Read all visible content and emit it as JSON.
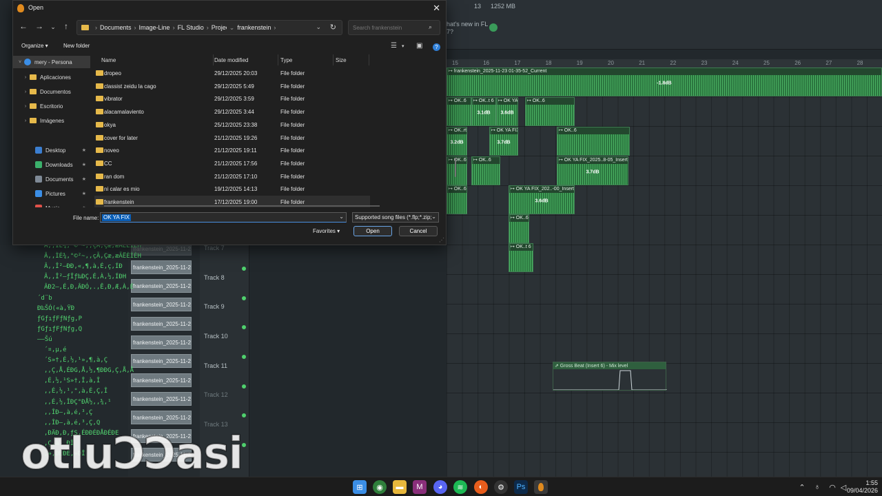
{
  "fl": {
    "top": {
      "counter_a": "13",
      "counter_b": "1252 MB",
      "news": "hat's new in FL",
      "news2": "7?"
    },
    "ruler": [
      "15",
      "16",
      "17",
      "18",
      "19",
      "20",
      "21",
      "22",
      "23",
      "24",
      "25",
      "26",
      "27",
      "28"
    ],
    "playlist_clips": [
      {
        "title": "↦ frankenstein_2025-11-23 01-35-52_Current",
        "db": "-1.8dB"
      },
      {
        "title": "↦ OK..6",
        "db": ""
      },
      {
        "title": "↦ OK..t 6",
        "db": "3.1dB"
      },
      {
        "title": "↦ OK YA FIX_..Insert 6",
        "db": "3.6dB"
      },
      {
        "title": "↦ OK..6",
        "db": ""
      },
      {
        "title": "↦ OK..rt 6",
        "db": "3.2dB"
      },
      {
        "title": "↦ OK YA FIX_2025-..7-51_Insert 6",
        "db": "3.7dB"
      },
      {
        "title": "↦ OK..6",
        "db": ""
      },
      {
        "title": "↦ OK YA FIX_2025..8-05_Insert 6",
        "db": "3.7dB"
      },
      {
        "title": "↦ OK YA FIX_202..-00_Insert 6",
        "db": "3.6dB"
      },
      {
        "title": "↦ OK..6",
        "db": ""
      },
      {
        "title": "↦ OK..t 6",
        "db": ""
      }
    ],
    "automation_clip": "⇗ Gross Beat (Insert 6) - Mix level",
    "tracks": [
      "Track 7",
      "Track 8",
      "Track 9",
      "Track 10",
      "Track 11",
      "Track 12",
      "Track 13"
    ],
    "pattern_label": "frankenstein_2025-11-2...",
    "tree_items": [
      "Â,,ÌÉ¾,°©²~,,çÃ,Çæ,æÃËÈÍÈH",
      "Â,,ÌÉ¾,°©²~,,çÃ,Çæ,æÃËÈÍÈH",
      "Â,,Î²—ÐÐ,«,¶,à,É,ç,ÍÐ",
      "Â,,Î²—ƒÎƒ‰ÐÇ,É,À,½,ÍÐH",
      "ÂÐ2—,É,Ð,ÂÐÓ,.,Ê,Ð,Æ,À,É",
      "´d¨b",
      "Ð‰ŠÓ(«à,ŸÐ",
      "ƒGƒıƒFƒNƒg,P",
      "ƒGƒıƒFƒNƒg,Q",
      "––Šú",
      "´¤,µ,é",
      "´S»†,É,½,¹»,¶,à,Ç",
      ",,Ç,Å,ÉÐG,Å,½,¶ÐÐG,Ç,Å,Å",
      ",É,½,¹S»†,Î,à,Î",
      ",,É,½,¹,°,à,É,Ç,Î",
      ",,É,½,ÎÐÇ°ÐÅ½,,¾,¹",
      ",,ÎÐ—,à,é,³,Ç",
      ",,ÎÐ—,à,é,³,Ç,Q",
      ",ÐÄÐ,Ð,ƒS,ÉÐÐÉÐÅÐÉÐE",
      ",Ç,à, ÐÎ",
      ",»,ÐÉÐE,»ÐÎ"
    ]
  },
  "dialog": {
    "title": "Open",
    "close_glyph": "✕",
    "nav": {
      "back": "←",
      "forward": "→",
      "down": "⌄",
      "up": "↑"
    },
    "breadcrumb": [
      "Documents",
      "Image-Line",
      "FL Studio",
      "Projects",
      "frankenstein"
    ],
    "search_placeholder": "Search frankenstein",
    "cmdbar": {
      "organize": "Organize ▾",
      "new_folder": "New folder"
    },
    "nav_pane": [
      {
        "label": "mery - Persona",
        "chev": "˅",
        "kind": "cloud",
        "selected": true
      },
      {
        "label": "Aplicaciones",
        "chev": "›",
        "kind": "folder"
      },
      {
        "label": "Documentos",
        "chev": "›",
        "kind": "folder"
      },
      {
        "label": "Escritorio",
        "chev": "›",
        "kind": "folder"
      },
      {
        "label": "Imágenes",
        "chev": "›",
        "kind": "folder"
      },
      {
        "label": "Desktop",
        "chev": "",
        "kind": "desktop"
      },
      {
        "label": "Downloads",
        "chev": "",
        "kind": "downloads"
      },
      {
        "label": "Documents",
        "chev": "",
        "kind": "documents"
      },
      {
        "label": "Pictures",
        "chev": "",
        "kind": "pictures"
      },
      {
        "label": "Music",
        "chev": "",
        "kind": "music"
      }
    ],
    "columns": {
      "name": "Name",
      "date": "Date modified",
      "type": "Type",
      "size": "Size"
    },
    "files": [
      {
        "name": "dropeo",
        "date": "29/12/2025 20:03",
        "type": "File folder"
      },
      {
        "name": "classist zeidu la cago",
        "date": "29/12/2025 5:49",
        "type": "File folder"
      },
      {
        "name": "vibrator",
        "date": "29/12/2025 3:59",
        "type": "File folder"
      },
      {
        "name": "alacamalaviento",
        "date": "29/12/2025 3:44",
        "type": "File folder"
      },
      {
        "name": "okya",
        "date": "25/12/2025 23:38",
        "type": "File folder"
      },
      {
        "name": "cover for later",
        "date": "21/12/2025 19:26",
        "type": "File folder"
      },
      {
        "name": "noveo",
        "date": "21/12/2025 19:11",
        "type": "File folder"
      },
      {
        "name": "CC",
        "date": "21/12/2025 17:56",
        "type": "File folder"
      },
      {
        "name": "ran dom",
        "date": "21/12/2025 17:10",
        "type": "File folder"
      },
      {
        "name": "ni calar es mio",
        "date": "19/12/2025 14:13",
        "type": "File folder"
      },
      {
        "name": "frankenstein",
        "date": "17/12/2025 19:00",
        "type": "File folder"
      }
    ],
    "file_name_label": "File name:",
    "file_name_value": "OK YA FIX",
    "file_type": "Supported song files (*.flp;*.zip;",
    "favorites": "Favorites",
    "open_label": "Open",
    "cancel_label": "Cancel"
  },
  "watermark": "otluƆƆasi",
  "taskbar": {
    "time": "1:55",
    "date": "09/04/2026"
  }
}
